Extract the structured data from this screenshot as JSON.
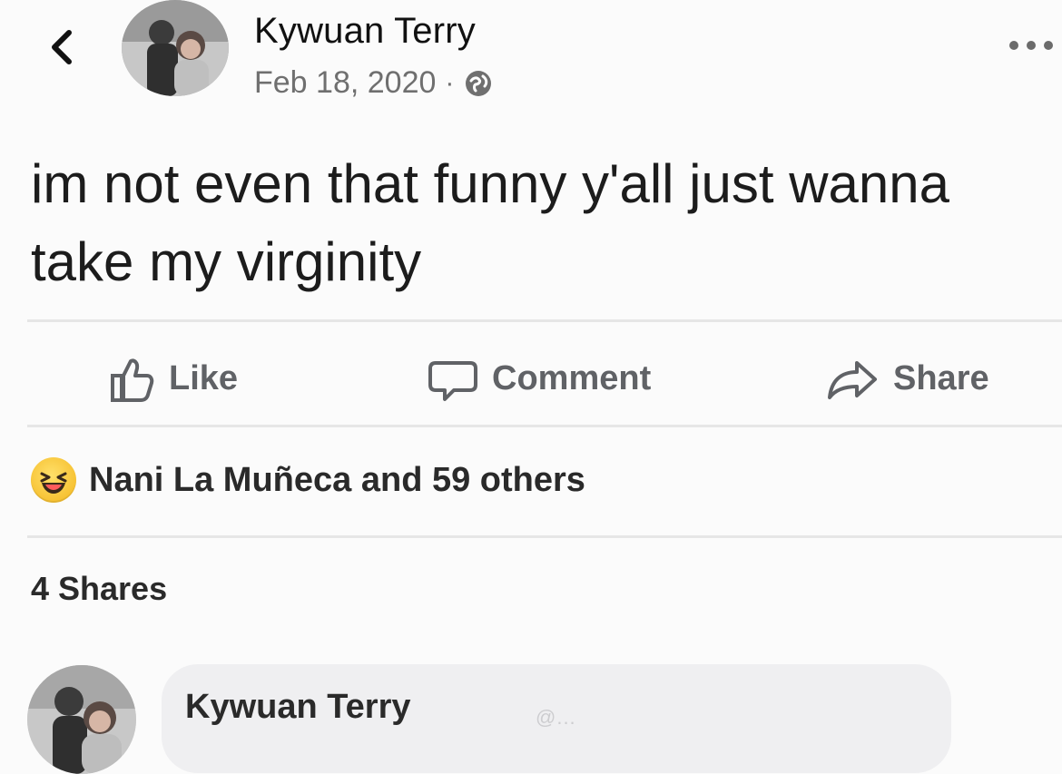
{
  "header": {
    "author_name": "Kywuan Terry",
    "date": "Feb 18, 2020",
    "separator": "·",
    "privacy_icon": "globe-icon",
    "back_icon": "chevron-left-icon",
    "more_icon": "more-horizontal-icon"
  },
  "post": {
    "text": "im not even that funny y'all just wanna take my virginity"
  },
  "actions": {
    "like_label": "Like",
    "comment_label": "Comment",
    "share_label": "Share"
  },
  "reactions": {
    "emoji_icon": "laughing-emoji-icon",
    "summary": "Nani La Muñeca and 59 others"
  },
  "shares": {
    "text": "4 Shares"
  },
  "comment": {
    "author_name": "Kywuan Terry",
    "watermark": "@..."
  },
  "colors": {
    "background": "#fbfbfb",
    "secondary_text": "#6f6f6f",
    "action_text": "#606266",
    "divider": "#e6e6e6",
    "comment_bubble": "#efeff1"
  }
}
